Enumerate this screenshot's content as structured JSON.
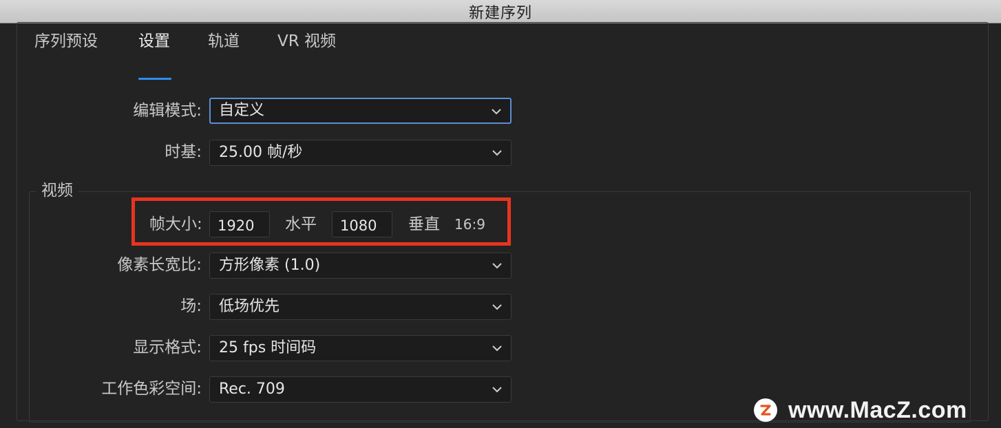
{
  "window": {
    "title": "新建序列"
  },
  "tabs": [
    {
      "label": "序列预设",
      "active": false
    },
    {
      "label": "设置",
      "active": true
    },
    {
      "label": "轨道",
      "active": false
    },
    {
      "label": "VR 视频",
      "active": false
    }
  ],
  "settings": {
    "editing_mode": {
      "label": "编辑模式:",
      "value": "自定义"
    },
    "timebase": {
      "label": "时基:",
      "value": "25.00  帧/秒"
    }
  },
  "video": {
    "section_title": "视频",
    "frame_size": {
      "label": "帧大小:",
      "width": "1920",
      "width_label": "水平",
      "height": "1080",
      "height_label": "垂直",
      "ratio": "16:9"
    },
    "pixel_aspect": {
      "label": "像素长宽比:",
      "value": "方形像素 (1.0)"
    },
    "fields": {
      "label": "场:",
      "value": "低场优先"
    },
    "display_format": {
      "label": "显示格式:",
      "value": "25 fps 时间码"
    },
    "working_color_space": {
      "label": "工作色彩空间:",
      "value": "Rec. 709"
    }
  },
  "watermark": {
    "text": "www.MacZ.com"
  },
  "colors": {
    "accent": "#2f8cf0",
    "highlight_box": "#e8341f",
    "background": "#232323",
    "field": "#1c1c1c"
  },
  "icons": {
    "dropdown": "chevron-down-icon",
    "watermark_logo": "macz-logo-icon"
  }
}
